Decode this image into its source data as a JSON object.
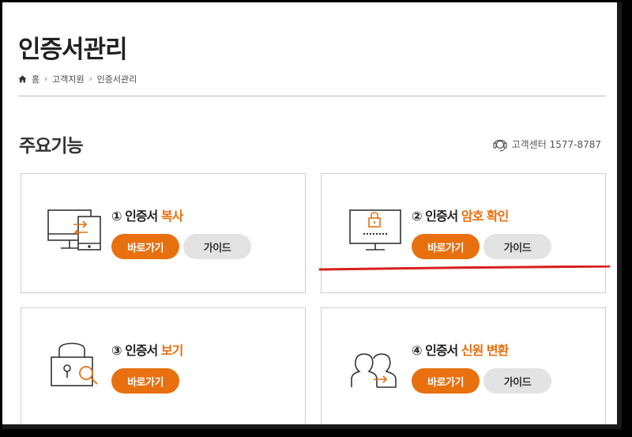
{
  "page": {
    "title": "인증서관리",
    "breadcrumb": {
      "home": "홈",
      "level1": "고객지원",
      "level2": "인증서관리"
    }
  },
  "section": {
    "title": "주요기능",
    "support_text": "고객센터 1577-8787"
  },
  "cards": [
    {
      "num_prefix": "① 인증서 ",
      "highlight": "복사",
      "go_label": "바로가기",
      "guide_label": "가이드",
      "icon": "monitor-transfer-icon"
    },
    {
      "num_prefix": "② 인증서 ",
      "highlight": "암호 확인",
      "go_label": "바로가기",
      "guide_label": "가이드",
      "icon": "monitor-lock-password-icon"
    },
    {
      "num_prefix": "③ 인증서 ",
      "highlight": "보기",
      "go_label": "바로가기",
      "icon": "lock-search-icon"
    },
    {
      "num_prefix": "④ 인증서 ",
      "highlight": "신원 변환",
      "go_label": "바로가기",
      "guide_label": "가이드",
      "icon": "users-transfer-icon"
    }
  ],
  "colors": {
    "accent": "#e8700f",
    "annotation_red": "#d6201f",
    "guide_bg": "#e3e3e3"
  }
}
